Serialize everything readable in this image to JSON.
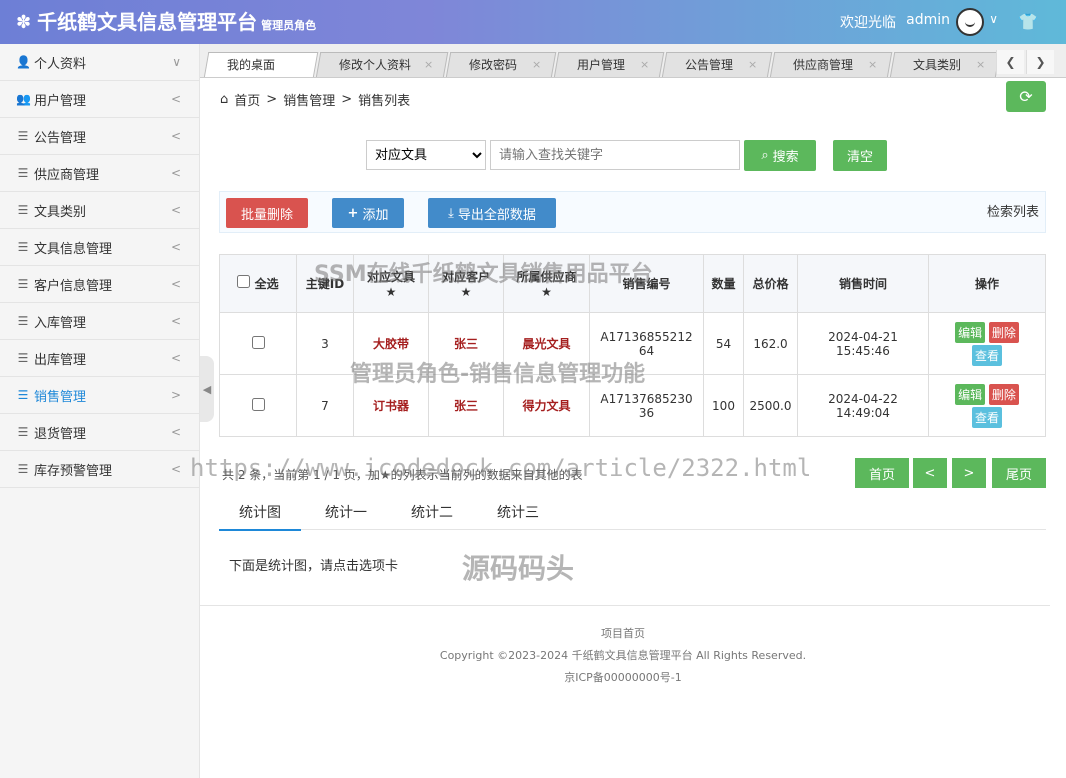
{
  "header": {
    "title": "千纸鹤文具信息管理平台",
    "role": "管理员角色",
    "welcome": "欢迎光临",
    "username": "admin"
  },
  "sidebar": {
    "items": [
      {
        "label": "个人资料",
        "icon": "user-icon",
        "arrow": "∨"
      },
      {
        "label": "用户管理",
        "icon": "users-icon",
        "arrow": "<"
      },
      {
        "label": "公告管理",
        "icon": "list-icon",
        "arrow": "<"
      },
      {
        "label": "供应商管理",
        "icon": "list-icon",
        "arrow": "<"
      },
      {
        "label": "文具类别",
        "icon": "list-icon",
        "arrow": "<"
      },
      {
        "label": "文具信息管理",
        "icon": "list-icon",
        "arrow": "<"
      },
      {
        "label": "客户信息管理",
        "icon": "list-icon",
        "arrow": "<"
      },
      {
        "label": "入库管理",
        "icon": "list-icon",
        "arrow": "<"
      },
      {
        "label": "出库管理",
        "icon": "list-icon",
        "arrow": "<"
      },
      {
        "label": "销售管理",
        "icon": "list-icon",
        "arrow": ">"
      },
      {
        "label": "退货管理",
        "icon": "list-icon",
        "arrow": "<"
      },
      {
        "label": "库存预警管理",
        "icon": "list-icon",
        "arrow": "<"
      }
    ]
  },
  "tabs": [
    "我的桌面",
    "修改个人资料",
    "修改密码",
    "用户管理",
    "公告管理",
    "供应商管理",
    "文具类别"
  ],
  "breadcrumb": {
    "home": "首页",
    "level1": "销售管理",
    "level2": "销售列表"
  },
  "search": {
    "select_value": "对应文具",
    "placeholder": "请输入查找关键字",
    "search_label": "搜索",
    "clear_label": "清空"
  },
  "toolbar": {
    "batch_delete": "批量删除",
    "add": "添加",
    "export": "导出全部数据",
    "title": "检索列表"
  },
  "table": {
    "headers": {
      "select_all": "全选",
      "id": "主键ID",
      "item": "对应文具",
      "customer": "对应客户",
      "supplier": "所属供应商",
      "number": "销售编号",
      "qty": "数量",
      "total": "总价格",
      "time": "销售时间",
      "ops": "操作"
    },
    "rows": [
      {
        "id": "3",
        "item": "大胶带",
        "customer": "张三",
        "supplier": "晨光文具",
        "number": "A1713685521264",
        "qty": "54",
        "total": "162.0",
        "time": "2024-04-21 15:45:46"
      },
      {
        "id": "7",
        "item": "订书器",
        "customer": "张三",
        "supplier": "得力文具",
        "number": "A1713768523036",
        "qty": "100",
        "total": "2500.0",
        "time": "2024-04-22 14:49:04"
      }
    ],
    "op_edit": "编辑",
    "op_delete": "删除",
    "op_view": "查看"
  },
  "pager": {
    "info": "共 2 条，当前第 1 / 1 页，加★的列表示当前列的数据来自其他的表",
    "first": "首页",
    "prev": "<",
    "next": ">",
    "last": "尾页"
  },
  "stats": {
    "tabs": [
      "统计图",
      "统计一",
      "统计二",
      "统计三"
    ],
    "desc": "下面是统计图，请点击选项卡"
  },
  "footer": {
    "home": "项目首页",
    "copyright": "Copyright ©2023-2024 千纸鹤文具信息管理平台 All Rights Reserved.",
    "icp": "京ICP备00000000号-1"
  },
  "watermarks": {
    "w1": "SSM在线千纸鹤文具销售用品平台",
    "w2": "管理员角色-销售信息管理功能",
    "w3": "https://www.icodedock.com/article/2322.html",
    "w4": "源码码头"
  },
  "colors": {
    "header_start": "#6d7fd6",
    "header_end": "#5fb9d9",
    "primary_green": "#5cb85c",
    "danger": "#d9534f",
    "primary_blue": "#428bca",
    "active_nav": "#1e88d8"
  }
}
